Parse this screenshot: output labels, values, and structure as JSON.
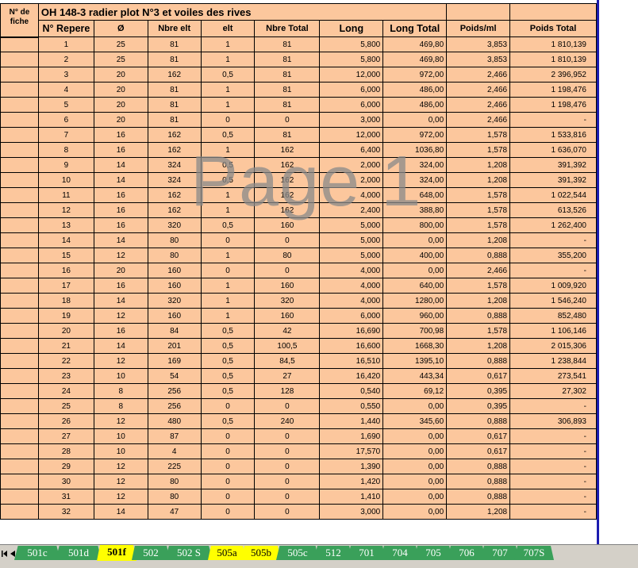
{
  "sheet": {
    "title": "OH 148-3 radier plot N°3 et voiles des rives",
    "fiche_header": "N° de fiche",
    "columns": [
      "N° Repere",
      "Ø",
      "Nbre elt",
      "elt",
      "Nbre Total",
      "Long",
      "Long Total",
      "Poids/ml",
      "Poids Total"
    ],
    "rows": [
      [
        "1",
        "25",
        "81",
        "1",
        "81",
        "5,800",
        "469,80",
        "3,853",
        "1 810,139"
      ],
      [
        "2",
        "25",
        "81",
        "1",
        "81",
        "5,800",
        "469,80",
        "3,853",
        "1 810,139"
      ],
      [
        "3",
        "20",
        "162",
        "0,5",
        "81",
        "12,000",
        "972,00",
        "2,466",
        "2 396,952"
      ],
      [
        "4",
        "20",
        "81",
        "1",
        "81",
        "6,000",
        "486,00",
        "2,466",
        "1 198,476"
      ],
      [
        "5",
        "20",
        "81",
        "1",
        "81",
        "6,000",
        "486,00",
        "2,466",
        "1 198,476"
      ],
      [
        "6",
        "20",
        "81",
        "0",
        "0",
        "3,000",
        "0,00",
        "2,466",
        "-"
      ],
      [
        "7",
        "16",
        "162",
        "0,5",
        "81",
        "12,000",
        "972,00",
        "1,578",
        "1 533,816"
      ],
      [
        "8",
        "16",
        "162",
        "1",
        "162",
        "6,400",
        "1036,80",
        "1,578",
        "1 636,070"
      ],
      [
        "9",
        "14",
        "324",
        "0,5",
        "162",
        "2,000",
        "324,00",
        "1,208",
        "391,392"
      ],
      [
        "10",
        "14",
        "324",
        "0,5",
        "162",
        "2,000",
        "324,00",
        "1,208",
        "391,392"
      ],
      [
        "11",
        "16",
        "162",
        "1",
        "162",
        "4,000",
        "648,00",
        "1,578",
        "1 022,544"
      ],
      [
        "12",
        "16",
        "162",
        "1",
        "162",
        "2,400",
        "388,80",
        "1,578",
        "613,526"
      ],
      [
        "13",
        "16",
        "320",
        "0,5",
        "160",
        "5,000",
        "800,00",
        "1,578",
        "1 262,400"
      ],
      [
        "14",
        "14",
        "80",
        "0",
        "0",
        "5,000",
        "0,00",
        "1,208",
        "-"
      ],
      [
        "15",
        "12",
        "80",
        "1",
        "80",
        "5,000",
        "400,00",
        "0,888",
        "355,200"
      ],
      [
        "16",
        "20",
        "160",
        "0",
        "0",
        "4,000",
        "0,00",
        "2,466",
        "-"
      ],
      [
        "17",
        "16",
        "160",
        "1",
        "160",
        "4,000",
        "640,00",
        "1,578",
        "1 009,920"
      ],
      [
        "18",
        "14",
        "320",
        "1",
        "320",
        "4,000",
        "1280,00",
        "1,208",
        "1 546,240"
      ],
      [
        "19",
        "12",
        "160",
        "1",
        "160",
        "6,000",
        "960,00",
        "0,888",
        "852,480"
      ],
      [
        "20",
        "16",
        "84",
        "0,5",
        "42",
        "16,690",
        "700,98",
        "1,578",
        "1 106,146"
      ],
      [
        "21",
        "14",
        "201",
        "0,5",
        "100,5",
        "16,600",
        "1668,30",
        "1,208",
        "2 015,306"
      ],
      [
        "22",
        "12",
        "169",
        "0,5",
        "84,5",
        "16,510",
        "1395,10",
        "0,888",
        "1 238,844"
      ],
      [
        "23",
        "10",
        "54",
        "0,5",
        "27",
        "16,420",
        "443,34",
        "0,617",
        "273,541"
      ],
      [
        "24",
        "8",
        "256",
        "0,5",
        "128",
        "0,540",
        "69,12",
        "0,395",
        "27,302"
      ],
      [
        "25",
        "8",
        "256",
        "0",
        "0",
        "0,550",
        "0,00",
        "0,395",
        "-"
      ],
      [
        "26",
        "12",
        "480",
        "0,5",
        "240",
        "1,440",
        "345,60",
        "0,888",
        "306,893"
      ],
      [
        "27",
        "10",
        "87",
        "0",
        "0",
        "1,690",
        "0,00",
        "0,617",
        "-"
      ],
      [
        "28",
        "10",
        "4",
        "0",
        "0",
        "17,570",
        "0,00",
        "0,617",
        "-"
      ],
      [
        "29",
        "12",
        "225",
        "0",
        "0",
        "1,390",
        "0,00",
        "0,888",
        "-"
      ],
      [
        "30",
        "12",
        "80",
        "0",
        "0",
        "1,420",
        "0,00",
        "0,888",
        "-"
      ],
      [
        "31",
        "12",
        "80",
        "0",
        "0",
        "1,410",
        "0,00",
        "0,888",
        "-"
      ],
      [
        "32",
        "14",
        "47",
        "0",
        "0",
        "3,000",
        "0,00",
        "1,208",
        "-"
      ]
    ]
  },
  "watermark": "Page 1",
  "tabs": [
    {
      "label": "501c",
      "active": false,
      "highlight": false
    },
    {
      "label": "501d",
      "active": false,
      "highlight": false
    },
    {
      "label": "501f",
      "active": true,
      "highlight": true
    },
    {
      "label": "502",
      "active": false,
      "highlight": false
    },
    {
      "label": "502 S",
      "active": false,
      "highlight": false
    },
    {
      "label": "505a",
      "active": false,
      "highlight": true
    },
    {
      "label": "505b",
      "active": false,
      "highlight": true
    },
    {
      "label": "505c",
      "active": false,
      "highlight": false
    },
    {
      "label": "512",
      "active": false,
      "highlight": false
    },
    {
      "label": "701",
      "active": false,
      "highlight": false
    },
    {
      "label": "704",
      "active": false,
      "highlight": false
    },
    {
      "label": "705",
      "active": false,
      "highlight": false
    },
    {
      "label": "706",
      "active": false,
      "highlight": false
    },
    {
      "label": "707",
      "active": false,
      "highlight": false
    },
    {
      "label": "707S",
      "active": false,
      "highlight": false
    }
  ],
  "colors": {
    "cell_bg": "#fcc79d",
    "title": "#e00000",
    "tab_green": "#3aa05a",
    "tab_yellow": "#ffff00",
    "page_break_line": "#1c1cb0"
  }
}
